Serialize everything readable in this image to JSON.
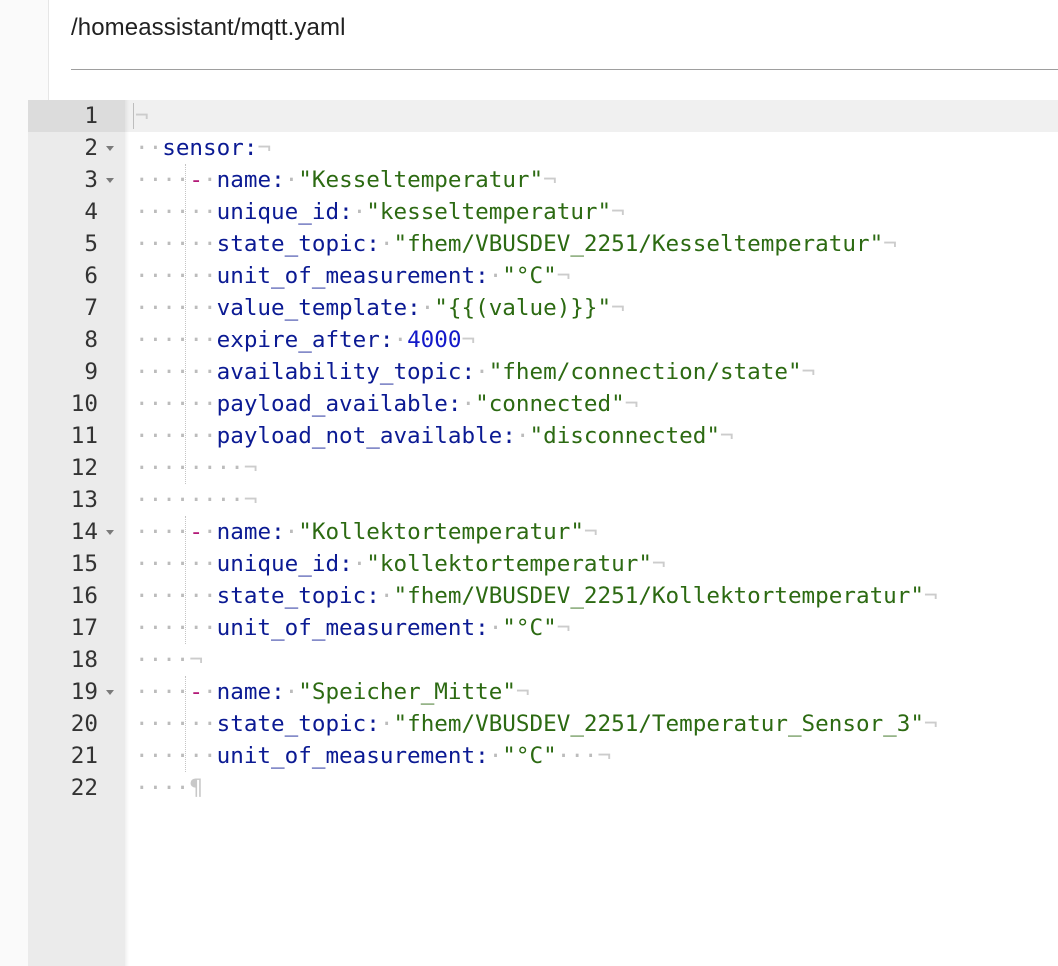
{
  "header": {
    "file_path": "/homeassistant/mqtt.yaml"
  },
  "editor": {
    "lines": [
      {
        "num": "1",
        "fold": false,
        "tokens": [
          {
            "t": "eol",
            "v": "¬"
          }
        ]
      },
      {
        "num": "2",
        "fold": true,
        "tokens": [
          {
            "t": "ws",
            "v": "··"
          },
          {
            "t": "key",
            "v": "sensor"
          },
          {
            "t": "punc",
            "v": ":"
          },
          {
            "t": "eol",
            "v": "¬"
          }
        ]
      },
      {
        "num": "3",
        "fold": true,
        "tokens": [
          {
            "t": "ws",
            "v": "····"
          },
          {
            "t": "dash",
            "v": "-"
          },
          {
            "t": "ws",
            "v": "·"
          },
          {
            "t": "key",
            "v": "name"
          },
          {
            "t": "punc",
            "v": ":"
          },
          {
            "t": "ws",
            "v": "·"
          },
          {
            "t": "str",
            "v": "\"Kesseltemperatur\""
          },
          {
            "t": "eol",
            "v": "¬"
          }
        ]
      },
      {
        "num": "4",
        "fold": false,
        "tokens": [
          {
            "t": "ws",
            "v": "······"
          },
          {
            "t": "key",
            "v": "unique_id"
          },
          {
            "t": "punc",
            "v": ":"
          },
          {
            "t": "ws",
            "v": "·"
          },
          {
            "t": "str",
            "v": "\"kesseltemperatur\""
          },
          {
            "t": "eol",
            "v": "¬"
          }
        ]
      },
      {
        "num": "5",
        "fold": false,
        "tokens": [
          {
            "t": "ws",
            "v": "······"
          },
          {
            "t": "key",
            "v": "state_topic"
          },
          {
            "t": "punc",
            "v": ":"
          },
          {
            "t": "ws",
            "v": "·"
          },
          {
            "t": "str",
            "v": "\"fhem/VBUSDEV_2251/Kesseltemperatur\""
          },
          {
            "t": "eol",
            "v": "¬"
          }
        ]
      },
      {
        "num": "6",
        "fold": false,
        "tokens": [
          {
            "t": "ws",
            "v": "······"
          },
          {
            "t": "key",
            "v": "unit_of_measurement"
          },
          {
            "t": "punc",
            "v": ":"
          },
          {
            "t": "ws",
            "v": "·"
          },
          {
            "t": "str",
            "v": "\"°C\""
          },
          {
            "t": "eol",
            "v": "¬"
          }
        ]
      },
      {
        "num": "7",
        "fold": false,
        "tokens": [
          {
            "t": "ws",
            "v": "······"
          },
          {
            "t": "key",
            "v": "value_template"
          },
          {
            "t": "punc",
            "v": ":"
          },
          {
            "t": "ws",
            "v": "·"
          },
          {
            "t": "str",
            "v": "\"{{(value)}}\""
          },
          {
            "t": "eol",
            "v": "¬"
          }
        ]
      },
      {
        "num": "8",
        "fold": false,
        "tokens": [
          {
            "t": "ws",
            "v": "······"
          },
          {
            "t": "key",
            "v": "expire_after"
          },
          {
            "t": "punc",
            "v": ":"
          },
          {
            "t": "ws",
            "v": "·"
          },
          {
            "t": "num",
            "v": "4000"
          },
          {
            "t": "eol",
            "v": "¬"
          }
        ]
      },
      {
        "num": "9",
        "fold": false,
        "tokens": [
          {
            "t": "ws",
            "v": "······"
          },
          {
            "t": "key",
            "v": "availability_topic"
          },
          {
            "t": "punc",
            "v": ":"
          },
          {
            "t": "ws",
            "v": "·"
          },
          {
            "t": "str",
            "v": "\"fhem/connection/state\""
          },
          {
            "t": "eol",
            "v": "¬"
          }
        ]
      },
      {
        "num": "10",
        "fold": false,
        "tokens": [
          {
            "t": "ws",
            "v": "······"
          },
          {
            "t": "key",
            "v": "payload_available"
          },
          {
            "t": "punc",
            "v": ":"
          },
          {
            "t": "ws",
            "v": "·"
          },
          {
            "t": "str",
            "v": "\"connected\""
          },
          {
            "t": "eol",
            "v": "¬"
          }
        ]
      },
      {
        "num": "11",
        "fold": false,
        "tokens": [
          {
            "t": "ws",
            "v": "······"
          },
          {
            "t": "key",
            "v": "payload_not_available"
          },
          {
            "t": "punc",
            "v": ":"
          },
          {
            "t": "ws",
            "v": "·"
          },
          {
            "t": "str",
            "v": "\"disconnected\""
          },
          {
            "t": "eol",
            "v": "¬"
          }
        ]
      },
      {
        "num": "12",
        "fold": false,
        "tokens": [
          {
            "t": "ws",
            "v": "········"
          },
          {
            "t": "eol",
            "v": "¬"
          }
        ]
      },
      {
        "num": "13",
        "fold": false,
        "tokens": [
          {
            "t": "ws",
            "v": "········"
          },
          {
            "t": "eol",
            "v": "¬"
          }
        ]
      },
      {
        "num": "14",
        "fold": true,
        "tokens": [
          {
            "t": "ws",
            "v": "····"
          },
          {
            "t": "dash",
            "v": "-"
          },
          {
            "t": "ws",
            "v": "·"
          },
          {
            "t": "key",
            "v": "name"
          },
          {
            "t": "punc",
            "v": ":"
          },
          {
            "t": "ws",
            "v": "·"
          },
          {
            "t": "str",
            "v": "\"Kollektortemperatur\""
          },
          {
            "t": "eol",
            "v": "¬"
          }
        ]
      },
      {
        "num": "15",
        "fold": false,
        "tokens": [
          {
            "t": "ws",
            "v": "······"
          },
          {
            "t": "key",
            "v": "unique_id"
          },
          {
            "t": "punc",
            "v": ":"
          },
          {
            "t": "ws",
            "v": "·"
          },
          {
            "t": "str",
            "v": "\"kollektortemperatur\""
          },
          {
            "t": "eol",
            "v": "¬"
          }
        ]
      },
      {
        "num": "16",
        "fold": false,
        "tokens": [
          {
            "t": "ws",
            "v": "······"
          },
          {
            "t": "key",
            "v": "state_topic"
          },
          {
            "t": "punc",
            "v": ":"
          },
          {
            "t": "ws",
            "v": "·"
          },
          {
            "t": "str",
            "v": "\"fhem/VBUSDEV_2251/Kollektortemperatur\""
          },
          {
            "t": "eol",
            "v": "¬"
          }
        ]
      },
      {
        "num": "17",
        "fold": false,
        "tokens": [
          {
            "t": "ws",
            "v": "······"
          },
          {
            "t": "key",
            "v": "unit_of_measurement"
          },
          {
            "t": "punc",
            "v": ":"
          },
          {
            "t": "ws",
            "v": "·"
          },
          {
            "t": "str",
            "v": "\"°C\""
          },
          {
            "t": "eol",
            "v": "¬"
          }
        ]
      },
      {
        "num": "18",
        "fold": false,
        "tokens": [
          {
            "t": "ws",
            "v": "····"
          },
          {
            "t": "eol",
            "v": "¬"
          }
        ]
      },
      {
        "num": "19",
        "fold": true,
        "tokens": [
          {
            "t": "ws",
            "v": "····"
          },
          {
            "t": "dash",
            "v": "-"
          },
          {
            "t": "ws",
            "v": "·"
          },
          {
            "t": "key",
            "v": "name"
          },
          {
            "t": "punc",
            "v": ":"
          },
          {
            "t": "ws",
            "v": "·"
          },
          {
            "t": "str",
            "v": "\"Speicher_Mitte\""
          },
          {
            "t": "eol",
            "v": "¬"
          }
        ]
      },
      {
        "num": "20",
        "fold": false,
        "tokens": [
          {
            "t": "ws",
            "v": "······"
          },
          {
            "t": "key",
            "v": "state_topic"
          },
          {
            "t": "punc",
            "v": ":"
          },
          {
            "t": "ws",
            "v": "·"
          },
          {
            "t": "str",
            "v": "\"fhem/VBUSDEV_2251/Temperatur_Sensor_3\""
          },
          {
            "t": "eol",
            "v": "¬"
          }
        ]
      },
      {
        "num": "21",
        "fold": false,
        "tokens": [
          {
            "t": "ws",
            "v": "······"
          },
          {
            "t": "key",
            "v": "unit_of_measurement"
          },
          {
            "t": "punc",
            "v": ":"
          },
          {
            "t": "ws",
            "v": "·"
          },
          {
            "t": "str",
            "v": "\"°C\""
          },
          {
            "t": "ws",
            "v": "···"
          },
          {
            "t": "eol",
            "v": "¬"
          }
        ]
      },
      {
        "num": "22",
        "fold": false,
        "tokens": [
          {
            "t": "ws",
            "v": "····"
          },
          {
            "t": "para",
            "v": "¶"
          }
        ]
      }
    ]
  },
  "colors": {
    "key": "#0b1a93",
    "string": "#2c6a12",
    "number": "#1319c9",
    "dash": "#b31a78",
    "whitespace": "#bcbcbc",
    "gutter": "#ebebeb"
  }
}
